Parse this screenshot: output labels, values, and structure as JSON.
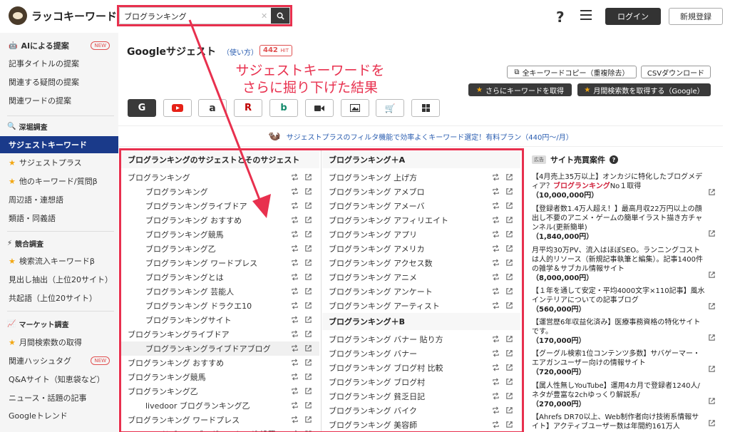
{
  "header": {
    "logo_text": "ラッコキーワード",
    "search_value": "ブログランキング",
    "help_glyph": "?",
    "login_label": "ログイン",
    "signup_label": "新規登録"
  },
  "sidebar": {
    "group1": [
      {
        "label": "AIによる提案",
        "new": "NEW"
      },
      {
        "label": "記事タイトルの提案"
      },
      {
        "label": "関連する疑問の提案"
      },
      {
        "label": "関連ワードの提案"
      }
    ],
    "section_deep": "深堀調査",
    "group2": [
      {
        "label": "サジェストキーワード"
      },
      {
        "label": "サジェストプラス"
      },
      {
        "label": "他のキーワード/質問β"
      },
      {
        "label": "周辺語・連想語"
      },
      {
        "label": "類語・同義語"
      }
    ],
    "section_compete": "競合調査",
    "group3": [
      {
        "label": "検索流入キーワードβ"
      },
      {
        "label": "見出し抽出（上位20サイト）"
      },
      {
        "label": "共起語（上位20サイト）"
      }
    ],
    "section_market": "マーケット調査",
    "group4": [
      {
        "label": "月間検索数の取得"
      },
      {
        "label": "関連ハッシュタグ",
        "new": "NEW"
      },
      {
        "label": "Q&Aサイト（知恵袋など）"
      },
      {
        "label": "ニュース・話題の記事"
      },
      {
        "label": "Googleトレンド"
      }
    ]
  },
  "main": {
    "title": "Googleサジェスト",
    "howto": "（使い方）",
    "hit_count": "442",
    "hit_unit": "HIT",
    "annotation_line1": "サジェストキーワードを",
    "annotation_line2": "さらに掘り下げた結果",
    "copy_all": "全キーワードコピー（重複除去）",
    "csv": "CSVダウンロード",
    "more_keywords": "さらにキーワードを取得",
    "monthly_volume": "月間検索数を取得する（Google）",
    "promo_text": "サジェストプラスのフィルタ機能で効率よくキーワード選定！有料プラン（440円〜/月）",
    "col1_title": "ブログランキングのサジェストとそのサジェスト",
    "col1_rows": [
      {
        "text": "ブログランキング",
        "indent": false
      },
      {
        "text": "ブログランキング",
        "indent": true
      },
      {
        "text": "ブログランキングライブドア",
        "indent": true
      },
      {
        "text": "ブログランキング おすすめ",
        "indent": true
      },
      {
        "text": "ブログランキング競馬",
        "indent": true
      },
      {
        "text": "ブログランキング乙",
        "indent": true
      },
      {
        "text": "ブログランキング ワードプレス",
        "indent": true
      },
      {
        "text": "ブログランキングとは",
        "indent": true
      },
      {
        "text": "ブログランキング 芸能人",
        "indent": true
      },
      {
        "text": "ブログランキング ドラクエ10",
        "indent": true
      },
      {
        "text": "ブログランキングサイト",
        "indent": true
      },
      {
        "text": "ブログランキングライブドア",
        "indent": false
      },
      {
        "text": "ブログランキングライブドアブログ",
        "indent": true,
        "highlight": true
      },
      {
        "text": "ブログランキング おすすめ",
        "indent": false
      },
      {
        "text": "ブログランキング競馬",
        "indent": false
      },
      {
        "text": "ブログランキング乙",
        "indent": false
      },
      {
        "text": "livedoor ブログランキング乙",
        "indent": true
      },
      {
        "text": "ブログランキング ワードプレス",
        "indent": false
      },
      {
        "text": "ワードプレス ブログランキング 設置",
        "indent": true
      }
    ],
    "col2_title_a": "ブログランキング＋A",
    "col2_rows_a": [
      "ブログランキング 上げ方",
      "ブログランキング アメブロ",
      "ブログランキング アメーバ",
      "ブログランキング アフィリエイト",
      "ブログランキング アプリ",
      "ブログランキング アメリカ",
      "ブログランキング アクセス数",
      "ブログランキング アニメ",
      "ブログランキング アンケート",
      "ブログランキング アーティスト"
    ],
    "col2_title_b": "ブログランキング＋B",
    "col2_rows_b": [
      "ブログランキング バナー 貼り方",
      "ブログランキング バナー",
      "ブログランキング ブログ村 比較",
      "ブログランキング ブログ村",
      "ブログランキング 貧乏日記",
      "ブログランキング バイク",
      "ブログランキング 美容師"
    ]
  },
  "ads": {
    "badge": "広告",
    "title": "サイト売買案件",
    "items": [
      {
        "pre": "【4月売上35万以上】オンカジに特化したブログメディア？",
        "red": "ブログランキング",
        "post": "No１取得",
        "price": "（10,000,000円）"
      },
      {
        "pre": "【登録者数1.4万人超え！】最高月収22万円以上の顔出し不要のアニメ・ゲームの簡単イラスト描き方チャンネル(更新簡単)",
        "red": "",
        "post": "",
        "price": "（1,840,000円）"
      },
      {
        "pre": "月平均30万PV、流入はほぼSEO。ランニングコストは人的リソース（新規記事執筆と編集）。記事1400件の雑学＆サブカル情報サイト",
        "red": "",
        "post": "",
        "price": "（8,000,000円）"
      },
      {
        "pre": "【１年を通して安定・平均4000文字×110記事】風水インテリアについての記事ブログ",
        "red": "",
        "post": "",
        "price": "（560,000円）"
      },
      {
        "pre": "【運営歴6年収益化済み】医療事務資格の特化サイトです。",
        "red": "",
        "post": "",
        "price": "（170,000円）"
      },
      {
        "pre": "【グーグル検索1位コンテンツ多数】サバゲーマー・エアガンユーザー向けの情報サイト",
        "red": "",
        "post": "",
        "price": "（720,000円）"
      },
      {
        "pre": "【属人性無しYouTube】運用4カ月で登録者1240人/ネタが豊富な2chゆっくり解説系/",
        "red": "",
        "post": "",
        "price": "（270,000円）"
      },
      {
        "pre": "【Ahrefs DR70以上、Web制作者向け技術系情報サイト】アクティブユーザー数は年間約161万人",
        "red": "",
        "post": "",
        "price": ""
      }
    ]
  },
  "colors": {
    "accent_red": "#e8304e",
    "active_nav": "#1a3a8a",
    "dark_button": "#333333",
    "star": "#f3a712"
  }
}
